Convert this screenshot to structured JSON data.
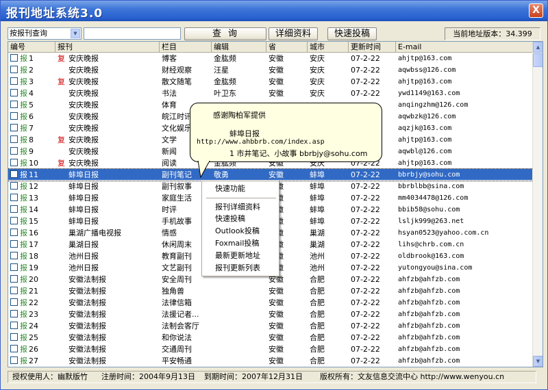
{
  "window": {
    "title": "报刊地址系统3.0",
    "close_label": "X"
  },
  "toolbar": {
    "query_type": "按报刊查询",
    "search_value": "",
    "query_button": "查询",
    "detail_button": "详细资料",
    "submit_button": "快速投稿",
    "version_text": "当前地址版本：34.399"
  },
  "table": {
    "headers": [
      "编号",
      "报刊",
      "栏目",
      "编辑",
      "省",
      "城市",
      "更新时间",
      "E-mail"
    ],
    "rows": [
      {
        "no": "1",
        "fu": "复",
        "paper": "安庆晚报",
        "column": "博客",
        "editor": "金肱频",
        "prov": "安徽",
        "city": "安庆",
        "date": "07-2-22",
        "email": "ahjtp@163.com"
      },
      {
        "no": "2",
        "fu": "",
        "paper": "安庆晚报",
        "column": "财经观察",
        "editor": "汪星",
        "prov": "安徽",
        "city": "安庆",
        "date": "07-2-22",
        "email": "aqwbss@126.com"
      },
      {
        "no": "3",
        "fu": "复",
        "paper": "安庆晚报",
        "column": "散文随笔",
        "editor": "金肱频",
        "prov": "安徽",
        "city": "安庆",
        "date": "07-2-22",
        "email": "ahjtp@163.com"
      },
      {
        "no": "4",
        "fu": "",
        "paper": "安庆晚报",
        "column": "书法",
        "editor": "叶卫东",
        "prov": "安徽",
        "city": "安庆",
        "date": "07-2-22",
        "email": "ywd1149@163.com"
      },
      {
        "no": "5",
        "fu": "",
        "paper": "安庆晚报",
        "column": "体育",
        "editor": "",
        "prov": "",
        "city": "",
        "date": "",
        "email": "anqingzhm@126.com"
      },
      {
        "no": "6",
        "fu": "",
        "paper": "安庆晚报",
        "column": "皖江时讯",
        "editor": "",
        "prov": "",
        "city": "",
        "date": "",
        "email": "aqwbzk@126.com"
      },
      {
        "no": "7",
        "fu": "",
        "paper": "安庆晚报",
        "column": "文化娱乐",
        "editor": "",
        "prov": "",
        "city": "",
        "date": "",
        "email": "aqzjk@163.com"
      },
      {
        "no": "8",
        "fu": "复",
        "paper": "安庆晚报",
        "column": "文学",
        "editor": "",
        "prov": "",
        "city": "",
        "date": "",
        "email": "ahjtp@163.com"
      },
      {
        "no": "9",
        "fu": "",
        "paper": "安庆晚报",
        "column": "新闻",
        "editor": "",
        "prov": "",
        "city": "",
        "date": "",
        "email": "aqwbl@126.com"
      },
      {
        "no": "10",
        "fu": "复",
        "paper": "安庆晚报",
        "column": "阅读",
        "editor": "金肱频",
        "prov": "安徽",
        "city": "安庆",
        "date": "07-2-22",
        "email": "ahjtp@163.com"
      },
      {
        "no": "11",
        "fu": "",
        "paper": "蚌埠日报",
        "column": "副刊笔记",
        "editor": "敬勇",
        "prov": "安徽",
        "city": "蚌埠",
        "date": "07-2-22",
        "email": "bbrbjy@sohu.com",
        "selected": true
      },
      {
        "no": "12",
        "fu": "",
        "paper": "蚌埠日报",
        "column": "副刊叙事",
        "editor": "",
        "prov": "安徽",
        "city": "蚌埠",
        "date": "07-2-22",
        "email": "bbrblbb@sina.com"
      },
      {
        "no": "13",
        "fu": "",
        "paper": "蚌埠日报",
        "column": "家庭生活",
        "editor": "",
        "prov": "安徽",
        "city": "蚌埠",
        "date": "07-2-22",
        "email": "mm4034478@126.com"
      },
      {
        "no": "14",
        "fu": "",
        "paper": "蚌埠日报",
        "column": "时评",
        "editor": "",
        "prov": "安徽",
        "city": "蚌埠",
        "date": "07-2-22",
        "email": "bbib58@sohu.com"
      },
      {
        "no": "15",
        "fu": "",
        "paper": "蚌埠日报",
        "column": "手机故事",
        "editor": "",
        "prov": "安徽",
        "city": "蚌埠",
        "date": "07-2-22",
        "email": "lsljk999@263.net"
      },
      {
        "no": "16",
        "fu": "",
        "paper": "巢湖广播电视报",
        "column": "情感",
        "editor": "",
        "prov": "安徽",
        "city": "巢湖",
        "date": "07-2-22",
        "email": "hsyan0523@yahoo.com.cn"
      },
      {
        "no": "17",
        "fu": "",
        "paper": "巢湖日报",
        "column": "休闲周末",
        "editor": "",
        "prov": "安徽",
        "city": "巢湖",
        "date": "07-2-22",
        "email": "lihs@chrb.com.cn"
      },
      {
        "no": "18",
        "fu": "",
        "paper": "池州日报",
        "column": "教育副刊",
        "editor": "",
        "prov": "安徽",
        "city": "池州",
        "date": "07-2-22",
        "email": "oldbrook@163.com"
      },
      {
        "no": "19",
        "fu": "",
        "paper": "池州日报",
        "column": "文艺副刊",
        "editor": "",
        "prov": "安徽",
        "city": "池州",
        "date": "07-2-22",
        "email": "yutongyou@sina.com"
      },
      {
        "no": "20",
        "fu": "",
        "paper": "安徽法制报",
        "column": "安全周刊",
        "editor": "",
        "prov": "安徽",
        "city": "合肥",
        "date": "07-2-22",
        "email": "ahfzb@ahfzb.com"
      },
      {
        "no": "21",
        "fu": "",
        "paper": "安徽法制报",
        "column": "独角兽",
        "editor": "",
        "prov": "安徽",
        "city": "合肥",
        "date": "07-2-22",
        "email": "ahfzb@ahfzb.com"
      },
      {
        "no": "22",
        "fu": "",
        "paper": "安徽法制报",
        "column": "法律信箱",
        "editor": "",
        "prov": "安徽",
        "city": "合肥",
        "date": "07-2-22",
        "email": "ahfzb@ahfzb.com"
      },
      {
        "no": "23",
        "fu": "",
        "paper": "安徽法制报",
        "column": "法援记者...",
        "editor": "",
        "prov": "安徽",
        "city": "合肥",
        "date": "07-2-22",
        "email": "ahfzb@ahfzb.com"
      },
      {
        "no": "24",
        "fu": "",
        "paper": "安徽法制报",
        "column": "法制会客厅",
        "editor": "",
        "prov": "安徽",
        "city": "合肥",
        "date": "07-2-22",
        "email": "ahfzb@ahfzb.com"
      },
      {
        "no": "25",
        "fu": "",
        "paper": "安徽法制报",
        "column": "和你说法",
        "editor": "",
        "prov": "安徽",
        "city": "合肥",
        "date": "07-2-22",
        "email": "ahfzb@ahfzb.com"
      },
      {
        "no": "26",
        "fu": "",
        "paper": "安徽法制报",
        "column": "交通周刊",
        "editor": "",
        "prov": "安徽",
        "city": "合肥",
        "date": "07-2-22",
        "email": "ahfzb@ahfzb.com"
      },
      {
        "no": "27",
        "fu": "",
        "paper": "安徽法制报",
        "column": "平安畅通",
        "editor": "",
        "prov": "安徽",
        "city": "合肥",
        "date": "07-2-22",
        "email": "ahfzb@ahfzb.com"
      }
    ]
  },
  "row_prefix": "报",
  "tooltip": {
    "line1": "感谢陶柏军提供",
    "line2": "蚌埠日报",
    "line3": "http://www.ahbbrb.com/index.asp",
    "line4": "1 市井笔记、小故事 bbrbjy@sohu.com"
  },
  "context_menu": {
    "items": [
      "快速功能",
      "报刊详细资料",
      "快速投稿",
      "Outlook投稿",
      "Foxmail投稿",
      "最新更新地址",
      "报刊更新列表"
    ]
  },
  "status": {
    "user": "授权使用人：幽默版竹",
    "reg": "注册时间：2004年9月13日",
    "expire": "到期时间：2007年12月31日",
    "copyright": "版权所有：文友信息交流中心 http://www.wenyou.cn"
  }
}
